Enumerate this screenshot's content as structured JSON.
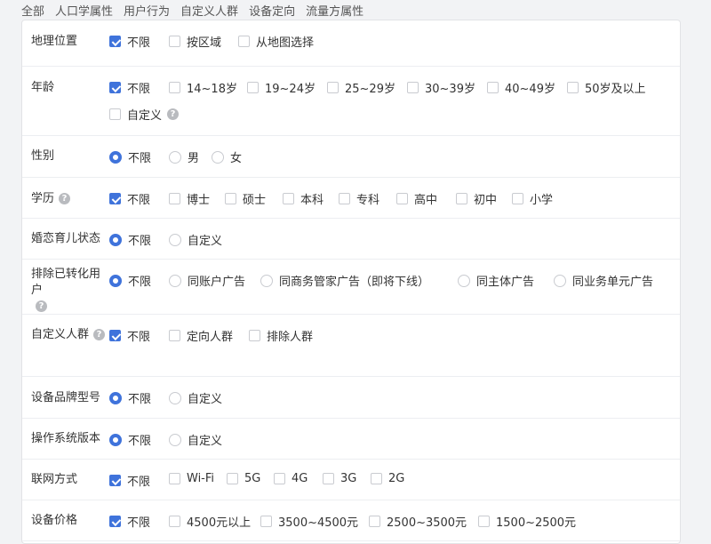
{
  "tabs": [
    "全部",
    "人口学属性",
    "用户行为",
    "自定义人群",
    "设备定向",
    "流量方属性"
  ],
  "accent_color": "#3f73db",
  "rows": [
    {
      "label": "地理位置",
      "options": [
        {
          "type": "checkbox",
          "text": "不限",
          "checked": true
        },
        {
          "type": "checkbox",
          "text": "按区域",
          "checked": false
        },
        {
          "type": "checkbox",
          "text": "从地图选择",
          "checked": false
        }
      ]
    },
    {
      "label": "年龄",
      "options": [
        {
          "type": "checkbox",
          "text": "不限",
          "checked": true
        },
        {
          "type": "checkbox",
          "text": "14~18岁",
          "checked": false
        },
        {
          "type": "checkbox",
          "text": "19~24岁",
          "checked": false
        },
        {
          "type": "checkbox",
          "text": "25~29岁",
          "checked": false
        },
        {
          "type": "checkbox",
          "text": "30~39岁",
          "checked": false
        },
        {
          "type": "checkbox",
          "text": "40~49岁",
          "checked": false
        },
        {
          "type": "checkbox",
          "text": "50岁及以上",
          "checked": false
        },
        {
          "type": "checkbox",
          "text": "自定义",
          "checked": false,
          "help": true
        }
      ]
    },
    {
      "label": "性别",
      "options": [
        {
          "type": "radio",
          "text": "不限",
          "checked": true
        },
        {
          "type": "radio",
          "text": "男",
          "checked": false
        },
        {
          "type": "radio",
          "text": "女",
          "checked": false
        }
      ]
    },
    {
      "label": "学历",
      "help": true,
      "options": [
        {
          "type": "checkbox",
          "text": "不限",
          "checked": true
        },
        {
          "type": "checkbox",
          "text": "博士",
          "checked": false
        },
        {
          "type": "checkbox",
          "text": "硕士",
          "checked": false
        },
        {
          "type": "checkbox",
          "text": "本科",
          "checked": false
        },
        {
          "type": "checkbox",
          "text": "专科",
          "checked": false
        },
        {
          "type": "checkbox",
          "text": "高中",
          "checked": false
        },
        {
          "type": "checkbox",
          "text": "初中",
          "checked": false
        },
        {
          "type": "checkbox",
          "text": "小学",
          "checked": false
        }
      ]
    },
    {
      "label": "婚恋育儿状态",
      "options": [
        {
          "type": "radio",
          "text": "不限",
          "checked": true
        },
        {
          "type": "radio",
          "text": "自定义",
          "checked": false
        }
      ]
    },
    {
      "label": "排除已转化用户",
      "help": true,
      "options": [
        {
          "type": "radio",
          "text": "不限",
          "checked": true
        },
        {
          "type": "radio",
          "text": "同账户广告",
          "checked": false
        },
        {
          "type": "radio",
          "text": "同商务管家广告（即将下线）",
          "checked": false
        },
        {
          "type": "radio",
          "text": "同主体广告",
          "checked": false
        },
        {
          "type": "radio",
          "text": "同业务单元广告",
          "checked": false
        }
      ]
    },
    {
      "label": "自定义人群",
      "help": true,
      "options": [
        {
          "type": "checkbox",
          "text": "不限",
          "checked": true
        },
        {
          "type": "checkbox",
          "text": "定向人群",
          "checked": false
        },
        {
          "type": "checkbox",
          "text": "排除人群",
          "checked": false
        }
      ]
    },
    {
      "label": "设备品牌型号",
      "options": [
        {
          "type": "radio",
          "text": "不限",
          "checked": true
        },
        {
          "type": "radio",
          "text": "自定义",
          "checked": false
        }
      ]
    },
    {
      "label": "操作系统版本",
      "options": [
        {
          "type": "radio",
          "text": "不限",
          "checked": true
        },
        {
          "type": "radio",
          "text": "自定义",
          "checked": false
        }
      ]
    },
    {
      "label": "联网方式",
      "options": [
        {
          "type": "checkbox",
          "text": "不限",
          "checked": true
        },
        {
          "type": "checkbox",
          "text": "Wi-Fi",
          "checked": false
        },
        {
          "type": "checkbox",
          "text": "5G",
          "checked": false
        },
        {
          "type": "checkbox",
          "text": "4G",
          "checked": false
        },
        {
          "type": "checkbox",
          "text": "3G",
          "checked": false
        },
        {
          "type": "checkbox",
          "text": "2G",
          "checked": false
        }
      ]
    },
    {
      "label": "设备价格",
      "options": [
        {
          "type": "checkbox",
          "text": "不限",
          "checked": true
        },
        {
          "type": "checkbox",
          "text": "4500元以上",
          "checked": false
        },
        {
          "type": "checkbox",
          "text": "3500~4500元",
          "checked": false
        },
        {
          "type": "checkbox",
          "text": "2500~3500元",
          "checked": false
        },
        {
          "type": "checkbox",
          "text": "1500~2500元",
          "checked": false
        }
      ]
    }
  ]
}
